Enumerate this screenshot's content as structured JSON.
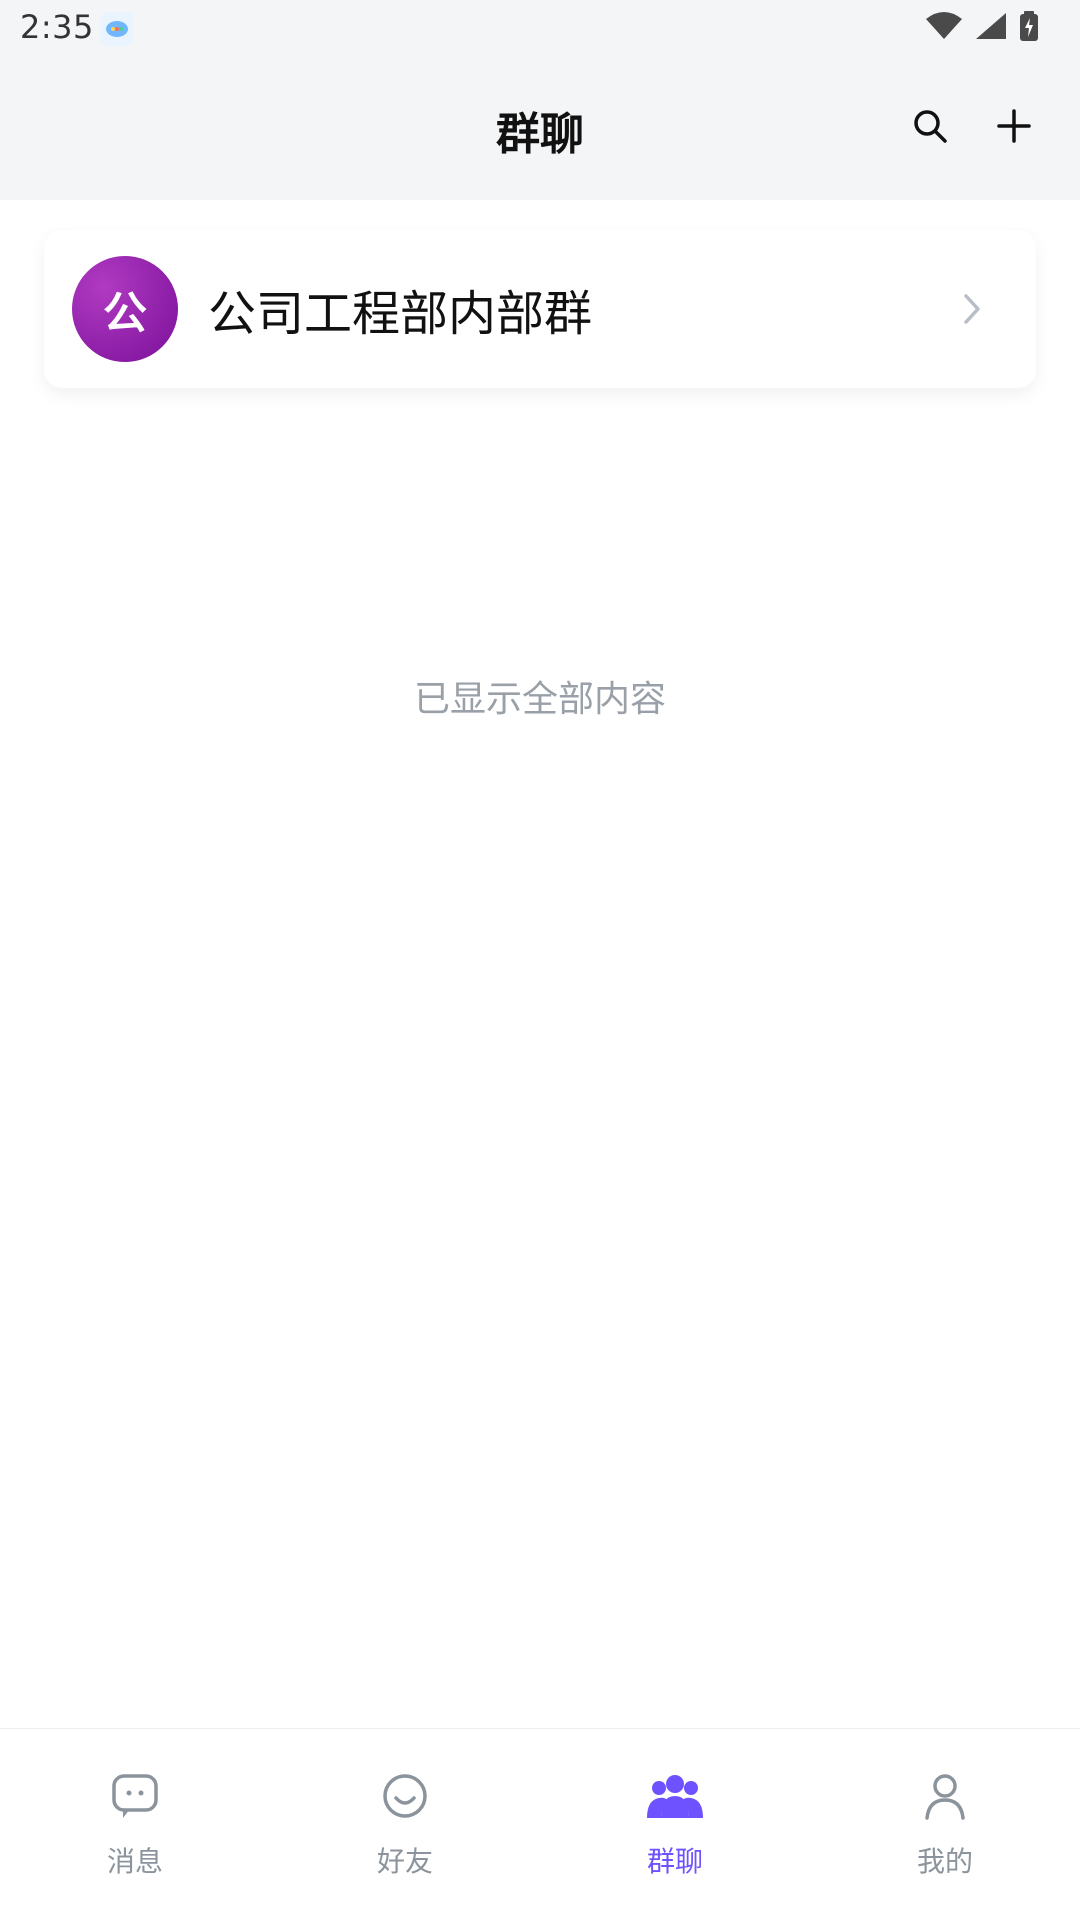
{
  "status_bar": {
    "time": "2:35",
    "app_icon": "chat-app-icon",
    "icons": [
      "wifi-icon",
      "signal-icon",
      "battery-charging-icon"
    ]
  },
  "header": {
    "title": "群聊",
    "actions": [
      {
        "name": "search",
        "icon": "search-icon"
      },
      {
        "name": "add",
        "icon": "plus-icon"
      }
    ]
  },
  "groups": [
    {
      "avatar_text": "公",
      "name": "公司工程部内部群",
      "avatar_color": "#8e1aa6"
    }
  ],
  "footer_note": "已显示全部内容",
  "bottom_nav": {
    "items": [
      {
        "key": "messages",
        "label": "消息",
        "icon": "message-icon",
        "active": false
      },
      {
        "key": "friends",
        "label": "好友",
        "icon": "smile-icon",
        "active": false
      },
      {
        "key": "groups",
        "label": "群聊",
        "icon": "group-icon",
        "active": true
      },
      {
        "key": "me",
        "label": "我的",
        "icon": "person-icon",
        "active": false
      }
    ],
    "active_color": "#6f52ff",
    "inactive_color": "#8b939c"
  }
}
